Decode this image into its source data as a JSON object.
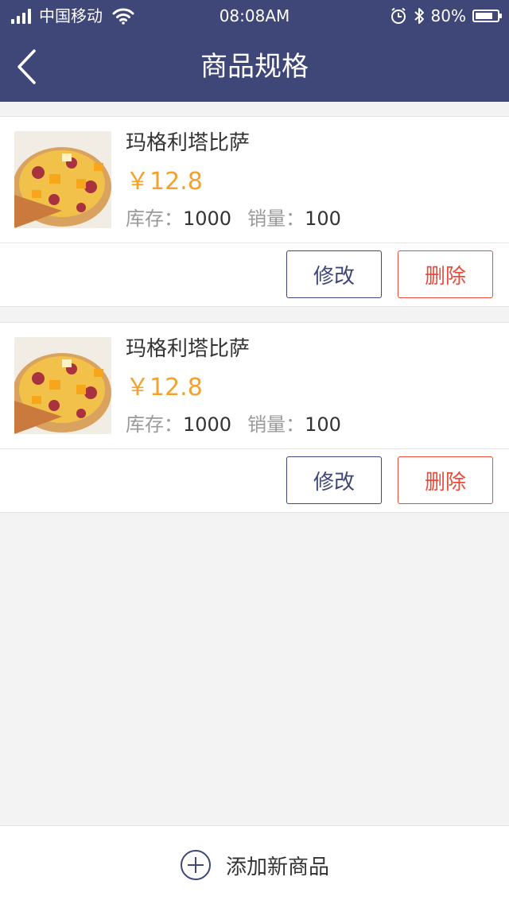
{
  "status_bar": {
    "carrier": "中国移动",
    "time": "08:08AM",
    "battery": "80%",
    "battery_level": 0.8
  },
  "header": {
    "title": "商品规格",
    "back_icon": "chevron-left-icon"
  },
  "products": [
    {
      "name": "玛格利塔比萨",
      "price": "￥12.8",
      "stock_label": "库存：",
      "stock": "1000",
      "sales_label": "销量：",
      "sales": "100",
      "edit_label": "修改",
      "delete_label": "删除"
    },
    {
      "name": "玛格利塔比萨",
      "price": "￥12.8",
      "stock_label": "库存：",
      "stock": "1000",
      "sales_label": "销量：",
      "sales": "100",
      "edit_label": "修改",
      "delete_label": "删除"
    }
  ],
  "footer": {
    "add_label": "添加新商品",
    "add_icon": "plus-circle-icon"
  },
  "colors": {
    "header_bg": "#3f4678",
    "price": "#f3a22c",
    "delete": "#e84b3a"
  }
}
